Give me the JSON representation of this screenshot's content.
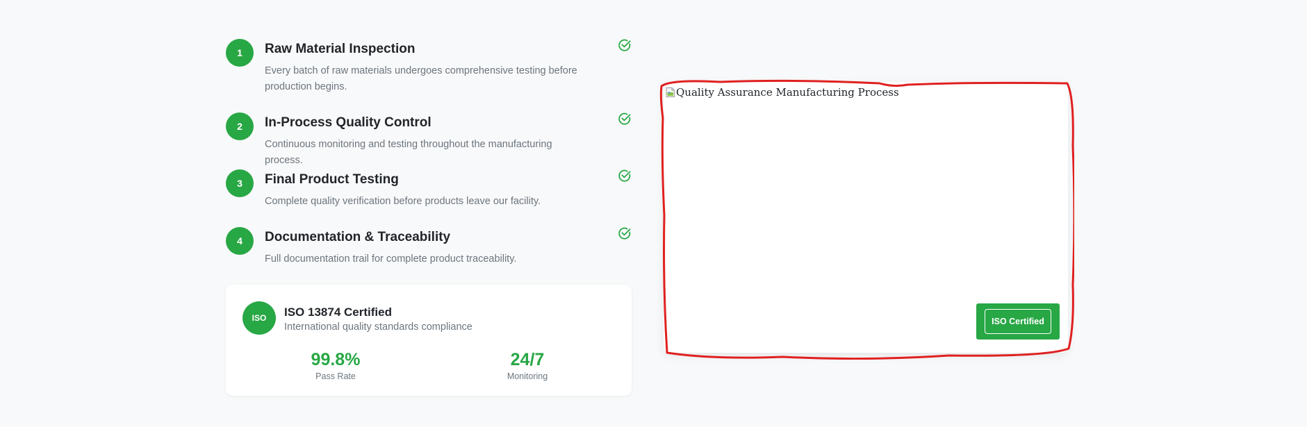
{
  "steps": [
    {
      "number": "1",
      "title": "Raw Material Inspection",
      "description": "Every batch of raw materials undergoes comprehensive testing before production begins."
    },
    {
      "number": "2",
      "title": "In-Process Quality Control",
      "description": "Continuous monitoring and testing throughout the manufacturing process."
    },
    {
      "number": "3",
      "title": "Final Product Testing",
      "description": "Complete quality verification before products leave our facility."
    },
    {
      "number": "4",
      "title": "Documentation & Traceability",
      "description": "Full documentation trail for complete product traceability."
    }
  ],
  "certification": {
    "badge": "ISO",
    "title": "ISO 13874 Certified",
    "subtitle": "International quality standards compliance",
    "stats": [
      {
        "value": "99.8%",
        "label": "Pass Rate"
      },
      {
        "value": "24/7",
        "label": "Monitoring"
      }
    ]
  },
  "image": {
    "alt": "Quality Assurance Manufacturing Process",
    "badge_label": "ISO Certified"
  },
  "colors": {
    "accent": "#28a745",
    "annotation": "#e02020"
  },
  "icons": {
    "step_status": "check-circle-icon",
    "image_placeholder": "broken-image-icon"
  }
}
